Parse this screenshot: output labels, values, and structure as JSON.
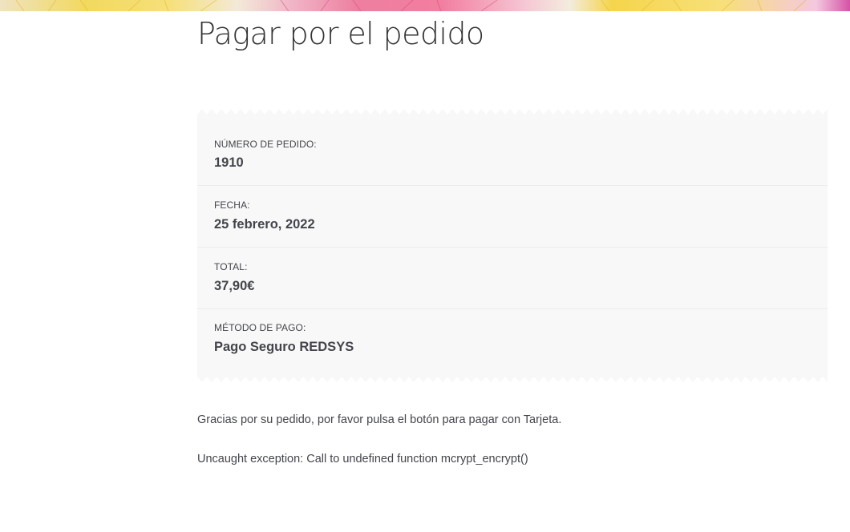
{
  "page": {
    "title": "Pagar por el pedido"
  },
  "order_details": {
    "items": [
      {
        "label": "NÚMERO DE PEDIDO:",
        "value": "1910"
      },
      {
        "label": "FECHA:",
        "value": "25 febrero, 2022"
      },
      {
        "label": "TOTAL:",
        "value": "37,90€"
      },
      {
        "label": "MÉTODO DE PAGO:",
        "value": "Pago Seguro REDSYS"
      }
    ]
  },
  "messages": {
    "thanks": "Gracias por su pedido, por favor pulsa el botón para pagar con Tarjeta.",
    "error": "Uncaught exception: Call to undefined function mcrypt_encrypt()"
  },
  "colors": {
    "text": "#43454b",
    "box_background": "#f8f8f8",
    "title": "#333333"
  }
}
